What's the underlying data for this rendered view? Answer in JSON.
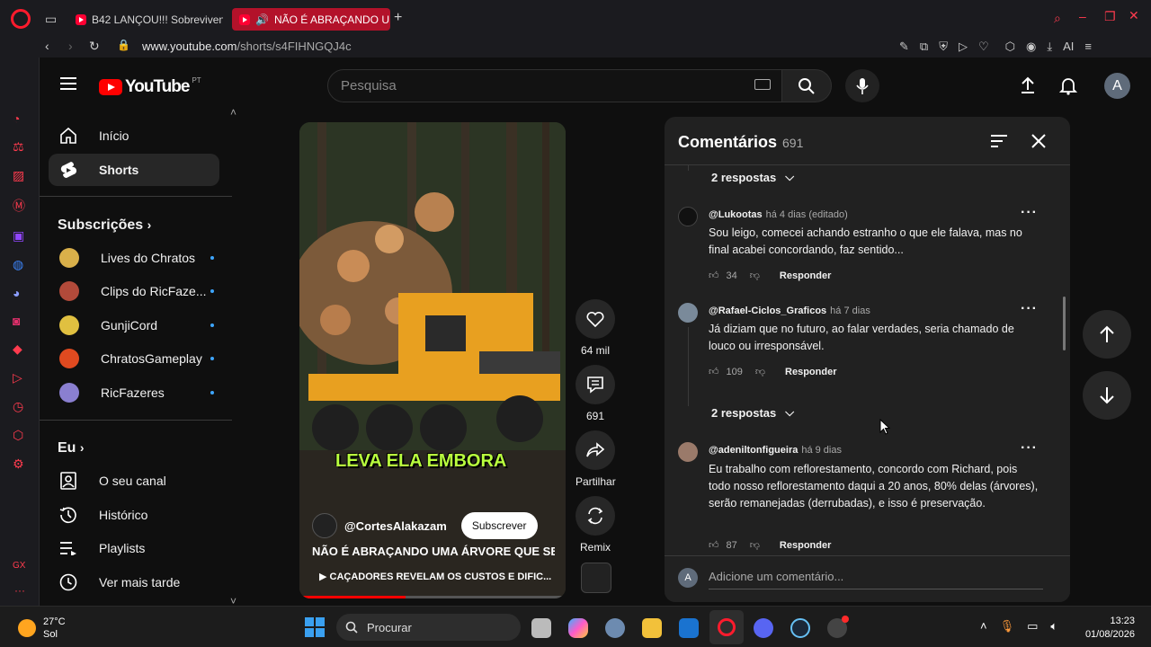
{
  "browser": {
    "tabs": [
      {
        "label": "B42 LANÇOU!!! Sobreviven"
      },
      {
        "label": "NÃO É ABRAÇANDO UM"
      }
    ],
    "url_host": "www.youtube.com",
    "url_path": "/shorts/s4FIHNGQJ4c",
    "ai_label": "AI"
  },
  "youtube": {
    "logo_text": "YouTube",
    "logo_country": "PT",
    "search_placeholder": "Pesquisa",
    "account_initial": "A"
  },
  "sidebar": {
    "primary": [
      {
        "label": "Início",
        "icon": "home-icon"
      },
      {
        "label": "Shorts",
        "icon": "shorts-icon"
      }
    ],
    "subscriptions_heading": "Subscrições",
    "subscriptions": [
      {
        "label": "Lives do Chratos",
        "color": "#d9b04a"
      },
      {
        "label": "Clips do RicFaze...",
        "color": "#b24a3a"
      },
      {
        "label": "GunjiCord",
        "color": "#e0c040"
      },
      {
        "label": "ChratosGameplay",
        "color": "#e04a20"
      },
      {
        "label": "RicFazeres",
        "color": "#8a7fd0"
      }
    ],
    "you_heading": "Eu",
    "you_items": [
      {
        "label": "O seu canal",
        "icon": "channel-icon"
      },
      {
        "label": "Histórico",
        "icon": "history-icon"
      },
      {
        "label": "Playlists",
        "icon": "playlist-icon"
      },
      {
        "label": "Ver mais tarde",
        "icon": "watch-later-icon"
      }
    ]
  },
  "video": {
    "caption": "LEVA ELA EMBORA",
    "channel": "@CortesAlakazam",
    "subscribe_label": "Subscrever",
    "title": "NÃO É ABRAÇANDO UMA ÁRVORE QUE SE ...",
    "related_link": "CAÇADORES REVELAM OS CUSTOS E DIFIC...",
    "likes": "64 mil",
    "comments_count": "691",
    "share_label": "Partilhar",
    "remix_label": "Remix"
  },
  "comments_panel": {
    "title": "Comentários",
    "count": "691",
    "replies_label": "2 respostas",
    "add_placeholder": "Adicione um comentário...",
    "comments": [
      {
        "author": "@Lukootas",
        "time": "há 4 dias (editado)",
        "text": "Sou leigo, comecei achando estranho o que ele falava, mas no final acabei concordando, faz sentido...",
        "likes": "34",
        "reply_label": "Responder",
        "avatar_color": "#111111"
      },
      {
        "author": "@Rafael-Ciclos_Graficos",
        "time": "há 7 dias",
        "text": "Já diziam que no futuro, ao falar verdades, seria chamado de louco ou irresponsável.",
        "likes": "109",
        "reply_label": "Responder",
        "avatar_color": "#7a8a9a"
      },
      {
        "author": "@adeniltonfigueira",
        "time": "há 9 dias",
        "text": "Eu trabalho com reflorestamento, concordo com Richard, pois todo nosso reflorestamento daqui a 20 anos, 80% delas (árvores), serão remanejadas (derrubadas), e isso é preservação.",
        "likes": "87",
        "reply_label": "Responder",
        "avatar_color": "#9a7a6a"
      }
    ]
  },
  "taskbar": {
    "temperature": "27°C",
    "weather": "Sol",
    "search_label": "Procurar",
    "time": "13:23",
    "date": "01/08/2026"
  }
}
